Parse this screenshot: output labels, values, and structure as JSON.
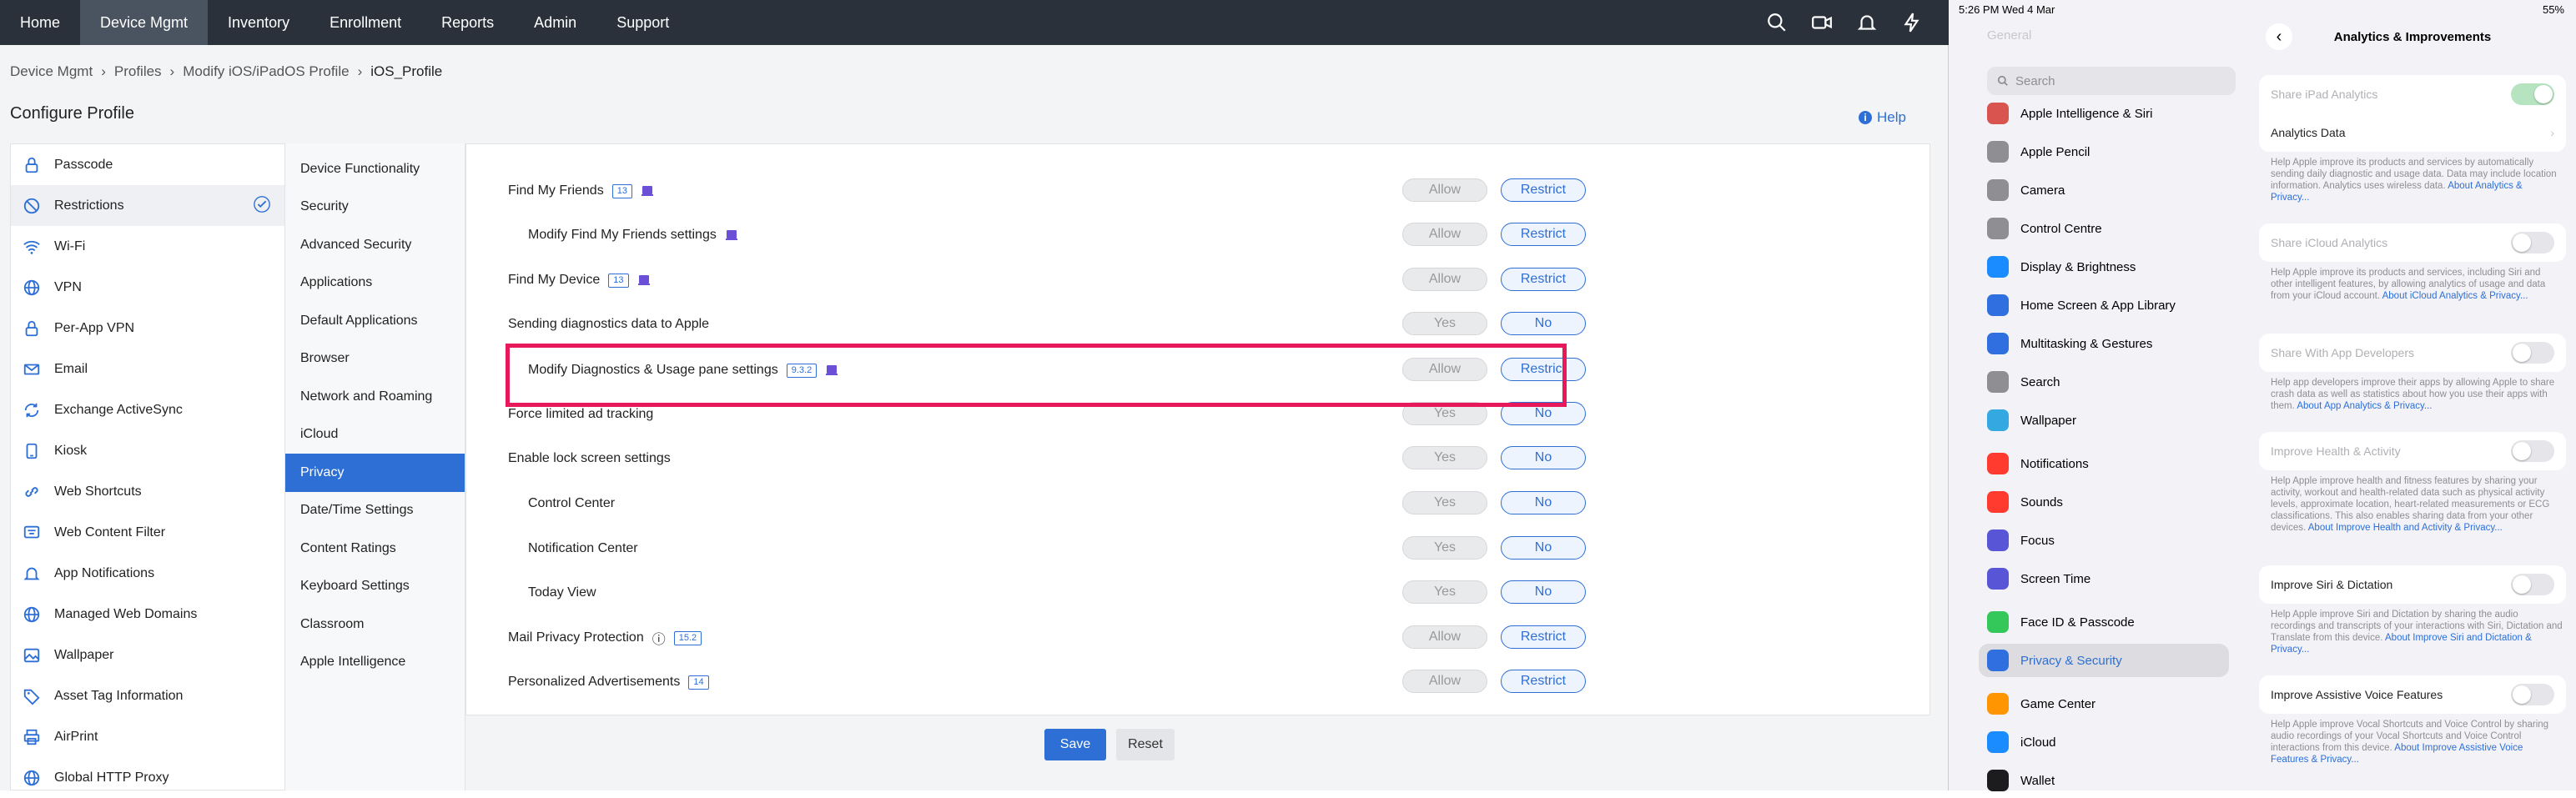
{
  "nav": {
    "items": [
      "Home",
      "Device Mgmt",
      "Inventory",
      "Enrollment",
      "Reports",
      "Admin",
      "Support"
    ],
    "active_index": 1
  },
  "breadcrumb": [
    "Device Mgmt",
    "Profiles",
    "Modify iOS/iPadOS Profile",
    "iOS_Profile"
  ],
  "page_title": "Configure Profile",
  "help_label": "Help",
  "payloads": [
    {
      "label": "Passcode",
      "icon": "lock-icon"
    },
    {
      "label": "Restrictions",
      "icon": "restrict-icon",
      "selected": true
    },
    {
      "label": "Wi-Fi",
      "icon": "wifi-icon"
    },
    {
      "label": "VPN",
      "icon": "globe-icon"
    },
    {
      "label": "Per-App VPN",
      "icon": "lock-icon"
    },
    {
      "label": "Email",
      "icon": "mail-icon"
    },
    {
      "label": "Exchange ActiveSync",
      "icon": "sync-icon"
    },
    {
      "label": "Kiosk",
      "icon": "kiosk-icon"
    },
    {
      "label": "Web Shortcuts",
      "icon": "link-icon"
    },
    {
      "label": "Web Content Filter",
      "icon": "filter-icon"
    },
    {
      "label": "App Notifications",
      "icon": "bell-icon"
    },
    {
      "label": "Managed Web Domains",
      "icon": "globe-icon"
    },
    {
      "label": "Wallpaper",
      "icon": "image-icon"
    },
    {
      "label": "Asset Tag Information",
      "icon": "tag-icon"
    },
    {
      "label": "AirPrint",
      "icon": "printer-icon"
    },
    {
      "label": "Global HTTP Proxy",
      "icon": "globe-icon"
    }
  ],
  "categories": [
    "Device Functionality",
    "Security",
    "Advanced Security",
    "Applications",
    "Default Applications",
    "Browser",
    "Network and Roaming",
    "iCloud",
    "Privacy",
    "Date/Time Settings",
    "Content Ratings",
    "Keyboard Settings",
    "Classroom",
    "Apple Intelligence"
  ],
  "categories_selected": 8,
  "settings": [
    {
      "label": "Find My Friends",
      "ver": "13",
      "ipad": true,
      "opt": [
        "Allow",
        "Restrict"
      ],
      "sel": 1,
      "indent": false
    },
    {
      "label": "Modify Find My Friends settings",
      "ver": "",
      "ipad": true,
      "opt": [
        "Allow",
        "Restrict"
      ],
      "sel": 1,
      "indent": true
    },
    {
      "label": "Find My Device",
      "ver": "13",
      "ipad": true,
      "opt": [
        "Allow",
        "Restrict"
      ],
      "sel": 1,
      "indent": false
    },
    {
      "label": "Sending diagnostics data to Apple",
      "ver": "",
      "ipad": false,
      "opt": [
        "Yes",
        "No"
      ],
      "sel": 1,
      "indent": false
    },
    {
      "label": "Modify Diagnostics & Usage pane settings",
      "ver": "9.3.2",
      "ipad": true,
      "opt": [
        "Allow",
        "Restrict"
      ],
      "sel": 1,
      "indent": true
    },
    {
      "label": "Force limited ad tracking",
      "ver": "",
      "ipad": false,
      "opt": [
        "Yes",
        "No"
      ],
      "sel": 1,
      "indent": false
    },
    {
      "label": "Enable lock screen settings",
      "ver": "",
      "ipad": false,
      "opt": [
        "Yes",
        "No"
      ],
      "sel": 1,
      "indent": false
    },
    {
      "label": "Control Center",
      "ver": "",
      "ipad": false,
      "opt": [
        "Yes",
        "No"
      ],
      "sel": 1,
      "indent": true
    },
    {
      "label": "Notification Center",
      "ver": "",
      "ipad": false,
      "opt": [
        "Yes",
        "No"
      ],
      "sel": 1,
      "indent": true
    },
    {
      "label": "Today View",
      "ver": "",
      "ipad": false,
      "opt": [
        "Yes",
        "No"
      ],
      "sel": 1,
      "indent": true
    },
    {
      "label": "Mail Privacy Protection",
      "ver": "15.2",
      "ipad": false,
      "info": true,
      "opt": [
        "Allow",
        "Restrict"
      ],
      "sel": 1,
      "indent": false
    },
    {
      "label": "Personalized Advertisements",
      "ver": "14",
      "ipad": false,
      "opt": [
        "Allow",
        "Restrict"
      ],
      "sel": 1,
      "indent": false
    }
  ],
  "save_label": "Save",
  "reset_label": "Reset",
  "ipad": {
    "time": "5:26 PM  Wed 4 Mar",
    "battery": "55%",
    "search_placeholder": "Search",
    "general_label": "General",
    "sidebar": [
      {
        "label": "Apple Intelligence & Siri",
        "color": "#d9534f"
      },
      {
        "label": "Apple Pencil",
        "color": "#8e8e93"
      },
      {
        "label": "Camera",
        "color": "#8e8e93"
      },
      {
        "label": "Control Centre",
        "color": "#8e8e93"
      },
      {
        "label": "Display & Brightness",
        "color": "#1a8cff"
      },
      {
        "label": "Home Screen & App Library",
        "color": "#2f6fe0"
      },
      {
        "label": "Multitasking & Gestures",
        "color": "#2f6fe0"
      },
      {
        "label": "Search",
        "color": "#8e8e93"
      },
      {
        "label": "Wallpaper",
        "color": "#34a8e0"
      },
      {
        "label": "Notifications",
        "color": "#ff3b30"
      },
      {
        "label": "Sounds",
        "color": "#ff3b30"
      },
      {
        "label": "Focus",
        "color": "#5856d6"
      },
      {
        "label": "Screen Time",
        "color": "#5856d6"
      },
      {
        "label": "Face ID & Passcode",
        "color": "#34c759"
      },
      {
        "label": "Privacy & Security",
        "color": "#2f6fe0",
        "selected": true
      },
      {
        "label": "Game Center",
        "color": "#ff9500"
      },
      {
        "label": "iCloud",
        "color": "#1a8cff"
      },
      {
        "label": "Wallet",
        "color": "#1c1c1e"
      }
    ],
    "detail_title": "Analytics & Improvements",
    "share_ipad": "Share iPad Analytics",
    "analytics_data": "Analytics Data",
    "note1": "Help Apple improve its products and services by automatically sending daily diagnostic and usage data. Data may include location information. Analytics uses wireless data.",
    "note1_link": "About Analytics & Privacy...",
    "share_icloud": "Share iCloud Analytics",
    "note2": "Help Apple improve its products and services, including Siri and other intelligent features, by allowing analytics of usage and data from your iCloud account.",
    "note2_link": "About iCloud Analytics & Privacy...",
    "share_dev": "Share With App Developers",
    "note3": "Help app developers improve their apps by allowing Apple to share crash data as well as statistics about how you use their apps with them.",
    "note3_link": "About App Analytics & Privacy...",
    "improve_health": "Improve Health & Activity",
    "note4": "Help Apple improve health and fitness features by sharing your activity, workout and health-related data such as physical activity levels, approximate location, heart-related measurements or ECG classifications. This also enables sharing data from your other devices.",
    "note4_link": "About Improve Health and Activity & Privacy...",
    "improve_siri": "Improve Siri & Dictation",
    "note5": "Help Apple improve Siri and Dictation by sharing the audio recordings and transcripts of your interactions with Siri, Dictation and Translate from this device.",
    "note5_link": "About Improve Siri and Dictation & Privacy...",
    "improve_voice": "Improve Assistive Voice Features",
    "note6": "Help Apple improve Vocal Shortcuts and Voice Control by sharing audio recordings of your Vocal Shortcuts and Voice Control interactions from this device.",
    "note6_link": "About Improve Assistive Voice Features & Privacy..."
  }
}
